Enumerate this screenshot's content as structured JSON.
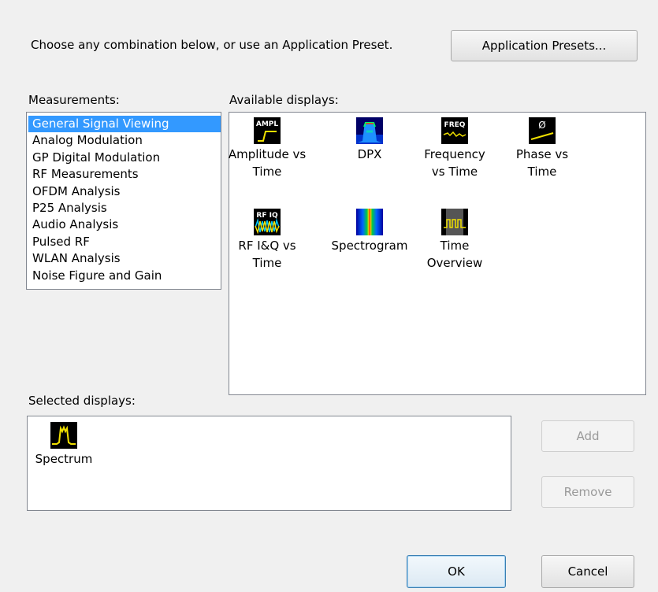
{
  "instruction": "Choose any combination below, or use an Application Preset.",
  "presets_button": "Application Presets...",
  "measurements_label": "Measurements:",
  "measurements": [
    {
      "label": "General Signal Viewing",
      "selected": true
    },
    {
      "label": "Analog Modulation",
      "selected": false
    },
    {
      "label": "GP Digital Modulation",
      "selected": false
    },
    {
      "label": "RF Measurements",
      "selected": false
    },
    {
      "label": "OFDM Analysis",
      "selected": false
    },
    {
      "label": "P25 Analysis",
      "selected": false
    },
    {
      "label": "Audio Analysis",
      "selected": false
    },
    {
      "label": "Pulsed RF",
      "selected": false
    },
    {
      "label": "WLAN Analysis",
      "selected": false
    },
    {
      "label": "Noise Figure and Gain",
      "selected": false
    }
  ],
  "available_label": "Available displays:",
  "available": [
    {
      "label": "Amplitude vs\nTime",
      "icon": "amplitude-icon",
      "icon_text": "AMPL"
    },
    {
      "label": "DPX",
      "icon": "dpx-icon"
    },
    {
      "label": "Frequency\nvs Time",
      "icon": "frequency-icon",
      "icon_text": "FREQ"
    },
    {
      "label": "Phase vs\nTime",
      "icon": "phase-icon",
      "icon_text": "Ø"
    },
    {
      "label": "RF I&Q vs\nTime",
      "icon": "rf-iq-icon",
      "icon_text": "RF IQ"
    },
    {
      "label": "Spectrogram",
      "icon": "spectrogram-icon"
    },
    {
      "label": "Time\nOverview",
      "icon": "time-overview-icon"
    }
  ],
  "selected_label": "Selected displays:",
  "selected": [
    {
      "label": "Spectrum",
      "icon": "spectrum-icon"
    }
  ],
  "buttons": {
    "add": "Add",
    "remove": "Remove",
    "ok": "OK",
    "cancel": "Cancel"
  },
  "colors": {
    "selection": "#3399ff",
    "icon_trace": "#f0e000",
    "icon_bg": "#000000"
  }
}
